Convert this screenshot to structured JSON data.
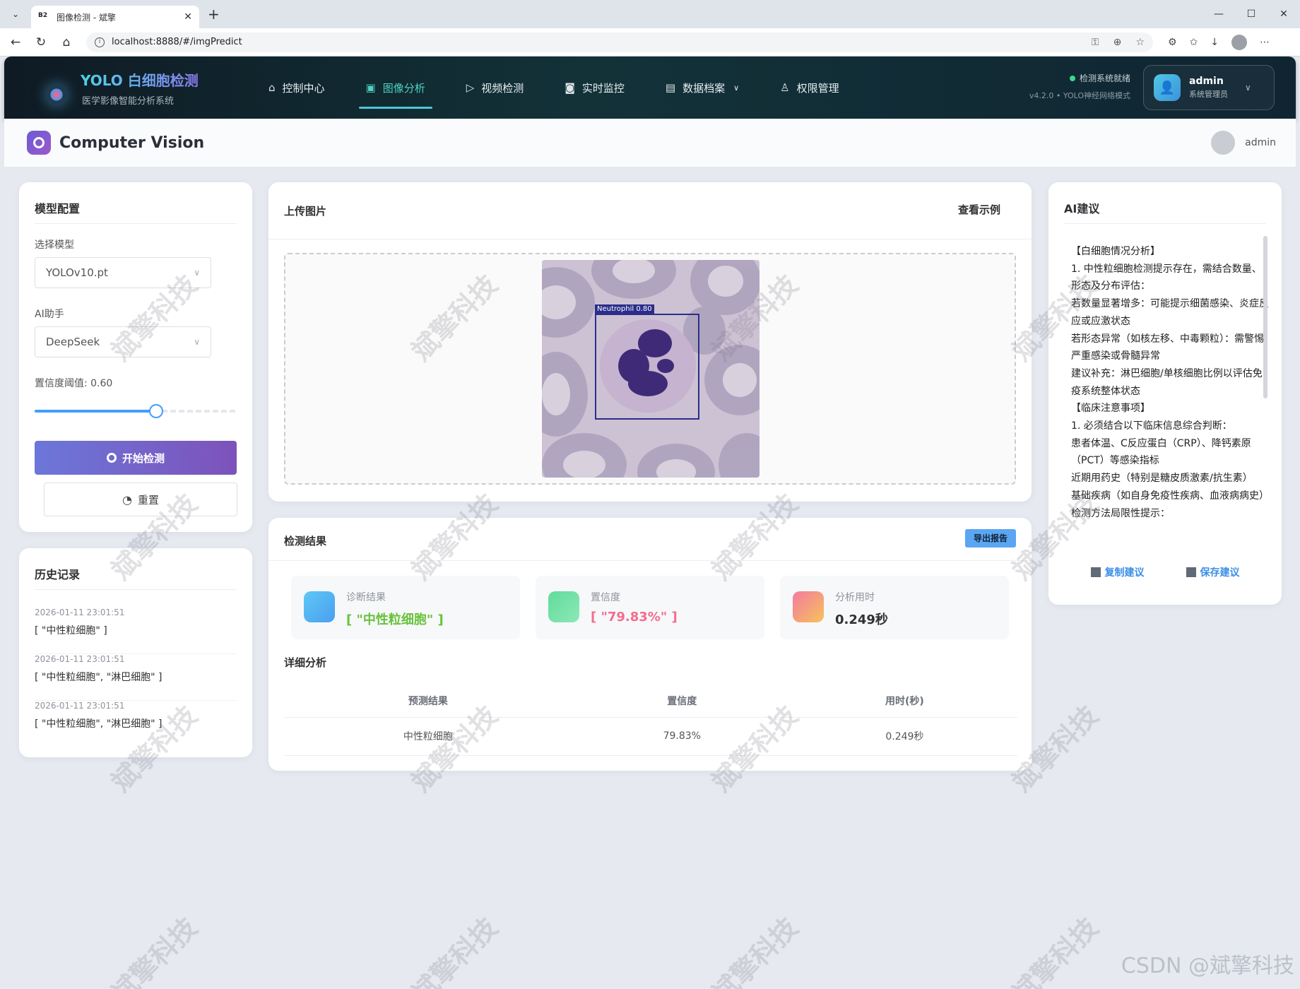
{
  "browser": {
    "tab_title": "图像检测 - 斌擎",
    "tab_favicon": "B2",
    "url": "localhost:8888/#/imgPredict"
  },
  "header": {
    "brand_title": "YOLO 白细胞检测",
    "brand_sub": "医学影像智能分析系统",
    "nav": [
      {
        "label": "控制中心",
        "icon": "home-icon"
      },
      {
        "label": "图像分析",
        "icon": "image-icon",
        "active": true
      },
      {
        "label": "视频检测",
        "icon": "play-icon"
      },
      {
        "label": "实时监控",
        "icon": "camera-icon"
      },
      {
        "label": "数据档案",
        "icon": "document-icon"
      },
      {
        "label": "权限管理",
        "icon": "user-icon"
      }
    ],
    "status_ready": "检测系统就绪",
    "status_version": "v4.2.0 • YOLO神经网络模式",
    "user_name": "admin",
    "user_role": "系统管理员"
  },
  "page": {
    "title": "Computer Vision",
    "user": "admin"
  },
  "config": {
    "title": "模型配置",
    "model_label": "选择模型",
    "model_value": "YOLOv10.pt",
    "assistant_label": "AI助手",
    "assistant_value": "DeepSeek",
    "threshold_label": "置信度阈值: 0.60",
    "threshold": 0.6,
    "start_button": "开始检测",
    "reset_button": "重置"
  },
  "history": {
    "title": "历史记录",
    "items": [
      {
        "time": "2026-01-11 23:01:51",
        "result": "[ \"中性粒细胞\" ]"
      },
      {
        "time": "2026-01-11 23:01:51",
        "result": "[ \"中性粒细胞\", \"淋巴细胞\" ]"
      },
      {
        "time": "2026-01-11 23:01:51",
        "result": "[ \"中性粒细胞\", \"淋巴细胞\" ]"
      }
    ]
  },
  "upload": {
    "title": "上传图片",
    "example_link": "查看示例",
    "detection_label": "Neutrophil  0.80"
  },
  "results": {
    "title": "检测结果",
    "export_button": "导出报告",
    "stats": [
      {
        "key": "诊断结果",
        "value": "[ \"中性粒细胞\" ]",
        "color": "#67c23a"
      },
      {
        "key": "置信度",
        "value": "[ \"79.83%\" ]",
        "color": "#f56c8c"
      },
      {
        "key": "分析用时",
        "value": "0.249秒",
        "color": "#303133"
      }
    ],
    "detail_title": "详细分析",
    "columns": [
      "预测结果",
      "置信度",
      "用时(秒)"
    ],
    "rows": [
      [
        "中性粒细胞",
        "79.83%",
        "0.249秒"
      ]
    ]
  },
  "ai": {
    "title": "AI建议",
    "lines": [
      "【白细胞情况分析】",
      "1. 中性粒细胞检测提示存在，需结合数量、形态及分布评估：",
      "若数量显著增多：可能提示细菌感染、炎症反应或应激状态",
      "若形态异常（如核左移、中毒颗粒）：需警惕严重感染或骨髓异常",
      "建议补充：淋巴细胞/单核细胞比例以评估免疫系统整体状态",
      "【临床注意事项】",
      "1. 必须结合以下临床信息综合判断：",
      "患者体温、C反应蛋白（CRP）、降钙素原（PCT）等感染指标",
      "近期用药史（特别是糖皮质激素/抗生素）",
      "基础疾病（如自身免疫性疾病、血液病病史）",
      "检测方法局限性提示："
    ],
    "copy_button": "复制建议",
    "save_button": "保存建议"
  },
  "watermark": "斌擎科技",
  "footer_mark": "CSDN @斌擎科技"
}
